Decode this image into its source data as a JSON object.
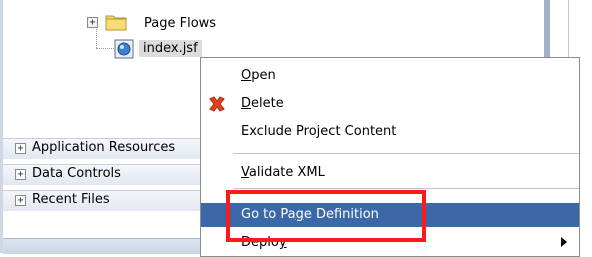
{
  "tree": {
    "folder_label": "Page Flows",
    "file_label": "index.jsf",
    "expander": "+"
  },
  "accordion": [
    {
      "label": "Application Resources",
      "icon": "+"
    },
    {
      "label": "Data Controls",
      "icon": "+"
    },
    {
      "label": "Recent Files",
      "icon": "+"
    }
  ],
  "menu": {
    "open": {
      "u": "O",
      "rest": "pen"
    },
    "delete": {
      "u": "D",
      "rest": "elete"
    },
    "exclude": "Exclude Project Content",
    "validate": {
      "u": "V",
      "rest": "alidate XML"
    },
    "goto": {
      "pre": "Go to Pa",
      "u": "g",
      "post": "e Definition"
    },
    "deploy": {
      "pre": "Deplo",
      "u": "y"
    }
  },
  "colors": {
    "highlight": "#3b68a8",
    "annotation": "#ff1a1a",
    "delete_icon": "#e0401a"
  }
}
